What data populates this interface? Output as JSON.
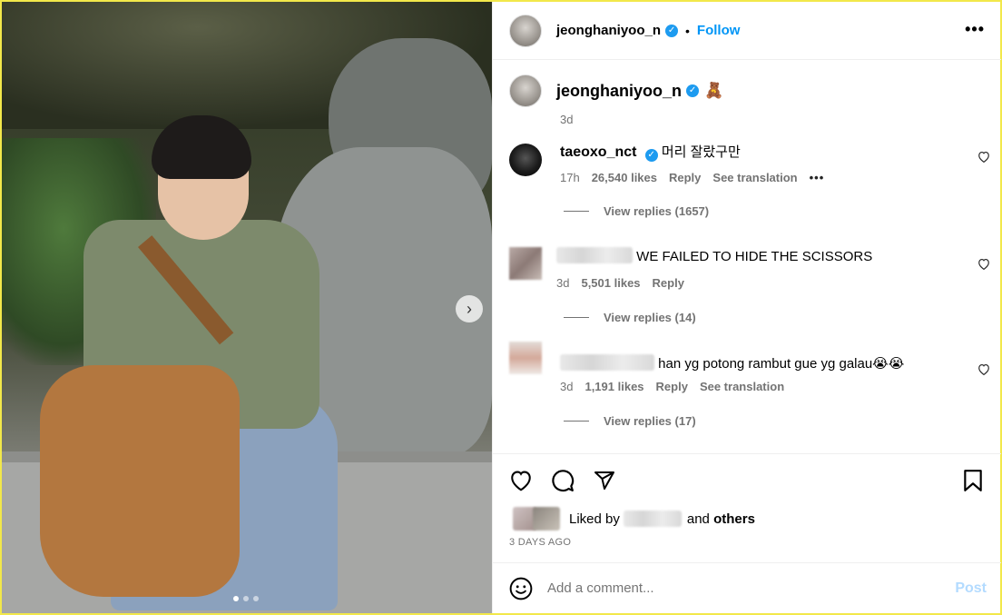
{
  "header": {
    "username": "jeonghaniyoo_n",
    "separator": "•",
    "follow_label": "Follow",
    "more_label": "•••"
  },
  "caption": {
    "username": "jeonghaniyoo_n",
    "emoji": "🧸",
    "time": "3d"
  },
  "comments": [
    {
      "username": "taeoxo_nct",
      "verified": true,
      "text": "머리 잘랐구만",
      "time": "17h",
      "likes": "26,540 likes",
      "reply_label": "Reply",
      "translation_label": "See translation",
      "more_label": "•••",
      "view_replies": "View replies (1657)"
    },
    {
      "username_blurred": true,
      "text": "WE FAILED TO HIDE THE SCISSORS",
      "time": "3d",
      "likes": "5,501 likes",
      "reply_label": "Reply",
      "view_replies": "View replies (14)"
    },
    {
      "username_blurred": true,
      "text": "han yg potong rambut gue yg galau😭😭",
      "time": "3d",
      "likes": "1,191 likes",
      "reply_label": "Reply",
      "translation_label": "See translation",
      "view_replies": "View replies (17)"
    }
  ],
  "likes_summary": {
    "prefix": "Liked by",
    "suffix": "and",
    "others": "others"
  },
  "post_date": "3 DAYS AGO",
  "add_comment": {
    "placeholder": "Add a comment...",
    "post_label": "Post"
  },
  "carousel": {
    "next_arrow": "›",
    "slide_count": 3,
    "active_slide": 1
  },
  "colors": {
    "accent": "#0095f6",
    "verified": "#1d9bf0",
    "muted": "#737373",
    "post_disabled": "#b3dbff",
    "border_highlight": "#f2e84a"
  },
  "icons": {
    "like": "heart-icon",
    "comment": "comment-icon",
    "share": "share-icon",
    "save": "bookmark-icon",
    "emoji": "smiley-icon"
  }
}
